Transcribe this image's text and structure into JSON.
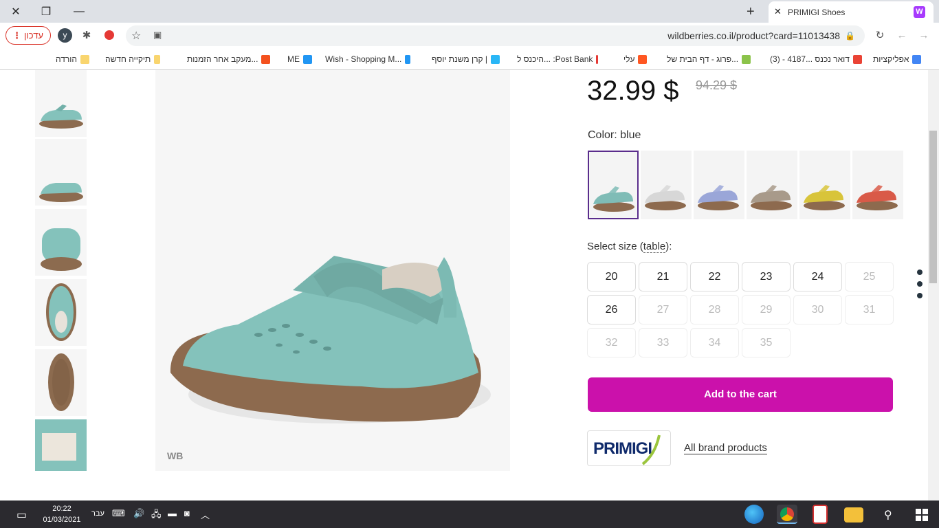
{
  "browser": {
    "tab_title": "PRIMIGI Shoes",
    "tab_favicon_letter": "W",
    "url": "wildberries.co.il/product?card=11013438",
    "update_label": "עדכון",
    "profile_initial": "y"
  },
  "bookmarks": [
    {
      "label": "אפליקציות",
      "color": "#4285f4"
    },
    {
      "label": "דואר נכנס ...4187 - (3)",
      "color": "#ea4335"
    },
    {
      "label": "פרוג - דף הבית של...",
      "color": "#8bc34a"
    },
    {
      "label": "עלי",
      "color": "#ff5722"
    },
    {
      "label": "היכנס ל... :Post Bank",
      "color": "#e53935"
    },
    {
      "label": "קרן משנת יוסף |",
      "color": "#29b6f6"
    },
    {
      "label": "Wish - Shopping M...",
      "color": "#2196f3"
    },
    {
      "label": "ME",
      "color": "#2196f3"
    },
    {
      "label": "מעקב אחר הזמנות...",
      "color": "#f4511e"
    },
    {
      "label": "תיקייה חדשה",
      "color": "#f9d56e"
    },
    {
      "label": "הורדה",
      "color": "#f9d56e"
    }
  ],
  "product": {
    "price": "32.99 $",
    "old_price": "94.29 $",
    "color_label": "Color: blue",
    "select_size_prefix": "Select size",
    "size_table_link": "table",
    "select_size_suffix": "):",
    "sizes": [
      {
        "size": "20",
        "available": true
      },
      {
        "size": "21",
        "available": true
      },
      {
        "size": "22",
        "available": true
      },
      {
        "size": "23",
        "available": true
      },
      {
        "size": "24",
        "available": true
      },
      {
        "size": "25",
        "available": false
      },
      {
        "size": "26",
        "available": true
      },
      {
        "size": "27",
        "available": false
      },
      {
        "size": "28",
        "available": false
      },
      {
        "size": "29",
        "available": false
      },
      {
        "size": "30",
        "available": false
      },
      {
        "size": "31",
        "available": false
      },
      {
        "size": "32",
        "available": false
      },
      {
        "size": "33",
        "available": false
      },
      {
        "size": "34",
        "available": false
      },
      {
        "size": "35",
        "available": false
      }
    ],
    "swatches": [
      {
        "name": "teal",
        "color": "#7fbcb6",
        "selected": true
      },
      {
        "name": "silver",
        "color": "#d7d7d7",
        "selected": false
      },
      {
        "name": "lavender",
        "color": "#9aa6d8",
        "selected": false
      },
      {
        "name": "taupe",
        "color": "#a89a8a",
        "selected": false
      },
      {
        "name": "yellow",
        "color": "#d8c43a",
        "selected": false
      },
      {
        "name": "red",
        "color": "#d95a48",
        "selected": false
      }
    ],
    "add_to_cart": "Add to the cart",
    "brand_name": "PRIMIGI",
    "brand_link": "All brand products",
    "watermark": "WB"
  },
  "taskbar": {
    "time": "20:22",
    "date": "01/03/2021",
    "language": "עבר"
  }
}
